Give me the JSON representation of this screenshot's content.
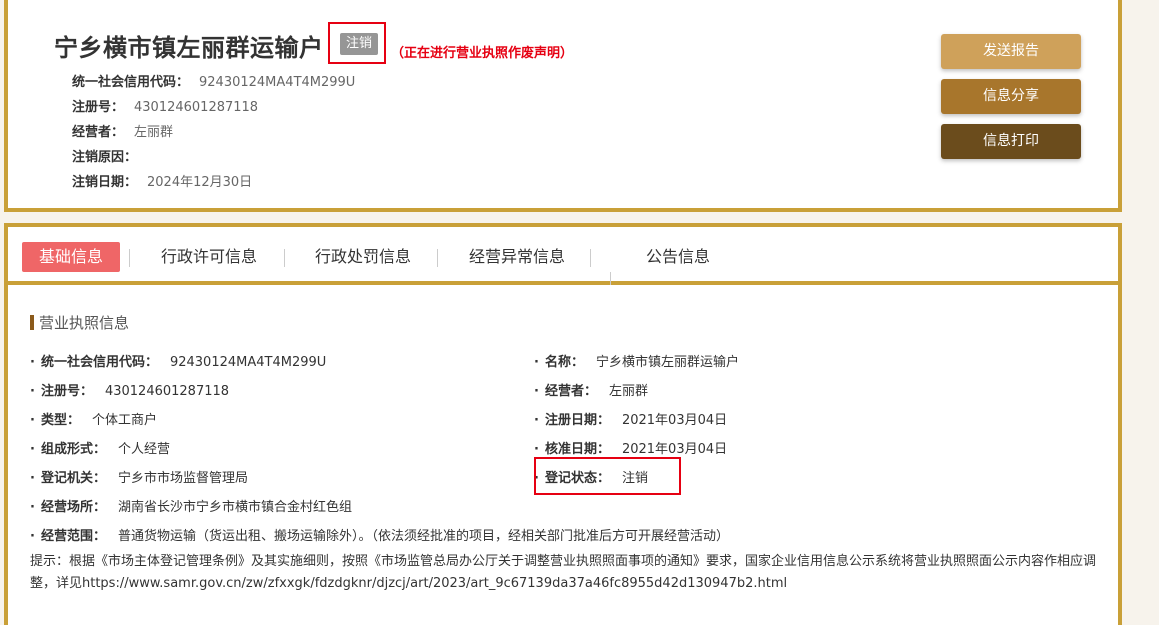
{
  "company": {
    "name": "宁乡横市镇左丽群运输户",
    "status_badge": "注销",
    "notice": "（正在进行营业执照作废声明）"
  },
  "summary": [
    {
      "key": "统一社会信用代码：",
      "value": "92430124MA4T4M299U"
    },
    {
      "key": "注册号：",
      "value": "430124601287118"
    },
    {
      "key": "经营者：",
      "value": "左丽群"
    },
    {
      "key": "注销原因：",
      "value": ""
    },
    {
      "key": "注销日期：",
      "value": "2024年12月30日"
    }
  ],
  "actions": {
    "report": "发送报告",
    "share": "信息分享",
    "print": "信息打印"
  },
  "tabs": [
    "基础信息",
    "行政许可信息",
    "行政处罚信息",
    "经营异常信息",
    "公告信息"
  ],
  "section_title": "营业执照信息",
  "fields_left": [
    {
      "key": "统一社会信用代码：",
      "value": "92430124MA4T4M299U"
    },
    {
      "key": "注册号：",
      "value": "430124601287118"
    },
    {
      "key": "类型：",
      "value": "个体工商户"
    },
    {
      "key": "组成形式：",
      "value": "个人经营"
    },
    {
      "key": "登记机关：",
      "value": "宁乡市市场监督管理局"
    },
    {
      "key": "经营场所：",
      "value": "湖南省长沙市宁乡市横市镇合金村红色组"
    },
    {
      "key": "经营范围：",
      "value": "普通货物运输（货运出租、搬场运输除外）。（依法须经批准的项目，经相关部门批准后方可开展经营活动）"
    }
  ],
  "fields_right": [
    {
      "key": "名称：",
      "value": "宁乡横市镇左丽群运输户"
    },
    {
      "key": "经营者：",
      "value": "左丽群"
    },
    {
      "key": "注册日期：",
      "value": "2021年03月04日"
    },
    {
      "key": "核准日期：",
      "value": "2021年03月04日"
    },
    {
      "key": "登记状态：",
      "value": "注销"
    }
  ],
  "tip": "提示：根据《市场主体登记管理条例》及其实施细则，按照《市场监管总局办公厅关于调整营业执照照面事项的通知》要求，国家企业信用信息公示系统将营业执照照面公示内容作相应调整，详见https://www.samr.gov.cn/zw/zfxxgk/fdzdgknr/djzcj/art/2023/art_9c67139da37a46fc8955d42d130947b2.html",
  "colors": {
    "border": "#c9a038",
    "highlight": "#e60012",
    "active_tab": "#ef6667"
  }
}
